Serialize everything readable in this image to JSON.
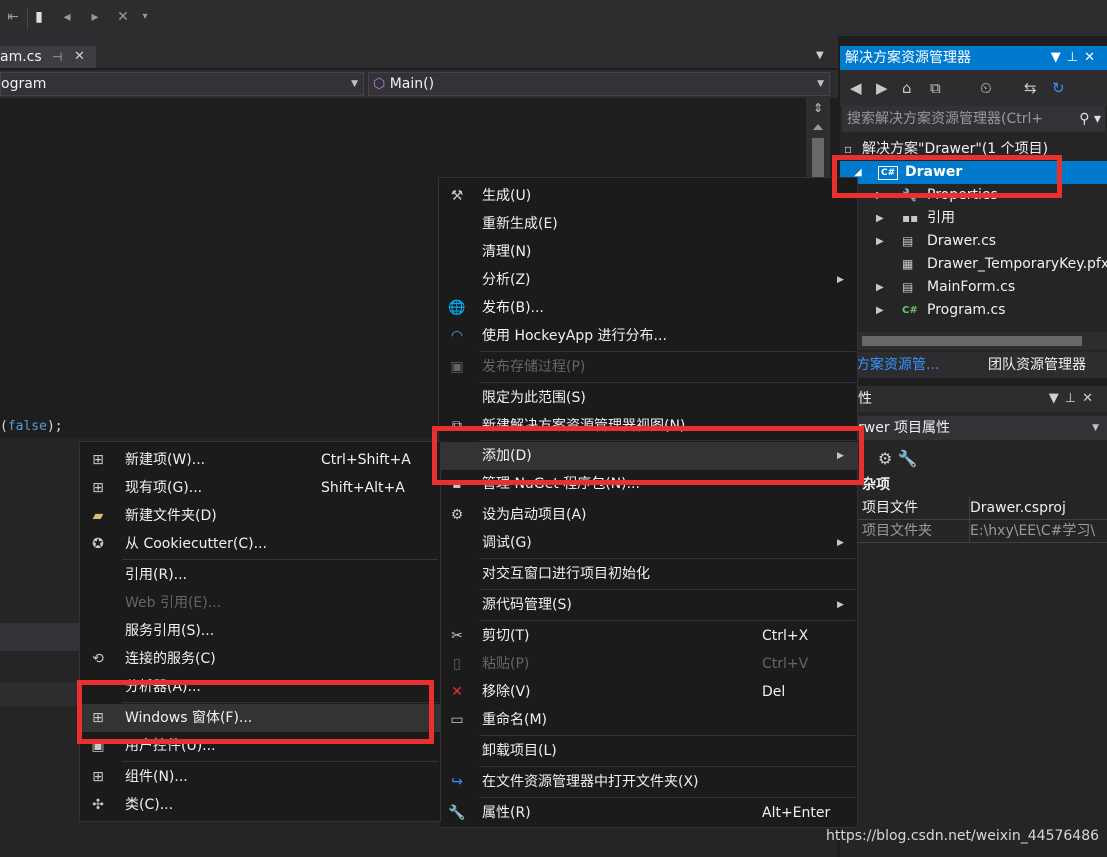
{
  "toolbar": {
    "icons": [
      "outdent-icon",
      "bookmark-icon",
      "prev-bookmark-icon",
      "next-bookmark-icon",
      "clear-bookmarks-icon",
      "toolbar-overflow-icon"
    ]
  },
  "editor": {
    "tab_label": "am.cs",
    "tab_pin": "⊣",
    "tab_close": "✕",
    "nav_left": "ogram",
    "nav_right": "Main()",
    "code_prefix": "(",
    "code_keyword": "false",
    "code_suffix": ");"
  },
  "solution_explorer": {
    "title": "解决方案资源管理器",
    "search_placeholder": "搜索解决方案资源管理器(Ctrl+",
    "items": [
      {
        "label": "解决方案\"Drawer\"(1 个项目)",
        "icon": "solution-icon"
      },
      {
        "label": "Drawer",
        "icon": "csharp-project-icon"
      },
      {
        "label": "Properties",
        "icon": "wrench-icon"
      },
      {
        "label": "引用",
        "icon": "references-icon"
      },
      {
        "label": "Drawer.cs",
        "icon": "form-icon"
      },
      {
        "label": "Drawer_TemporaryKey.pfx",
        "icon": "certificate-icon"
      },
      {
        "label": "MainForm.cs",
        "icon": "form-icon"
      },
      {
        "label": "Program.cs",
        "icon": "csharp-file-icon"
      }
    ],
    "tab_active": "决方案资源管...",
    "tab_other": "团队资源管理器"
  },
  "properties": {
    "title": "性",
    "combo_label": "rwer 项目属性",
    "category": "杂项",
    "rows": [
      {
        "key": "项目文件",
        "value": "Drawer.csproj"
      },
      {
        "key": "项目文件夹",
        "value": "E:\\hxy\\EE\\C#学习\\"
      }
    ]
  },
  "context_menu": {
    "items": [
      {
        "label": "生成(U)",
        "icon": "build-icon"
      },
      {
        "label": "重新生成(E)"
      },
      {
        "label": "清理(N)"
      },
      {
        "label": "分析(Z)",
        "submenu": true
      },
      {
        "label": "发布(B)...",
        "icon": "globe-icon"
      },
      {
        "label": "使用 HockeyApp 进行分布...",
        "icon": "hockeyapp-icon"
      },
      {
        "label": "发布存储过程(P)",
        "icon": "db-publish-icon",
        "disabled": true
      },
      {
        "label": "限定为此范围(S)"
      },
      {
        "label": "新建解决方案资源管理器视图(N)",
        "icon": "new-view-icon"
      },
      {
        "label": "添加(D)",
        "submenu": true,
        "highlighted": true
      },
      {
        "label": "管理 NuGet 程序包(N)...",
        "icon": "nuget-icon"
      },
      {
        "label": "设为启动项目(A)",
        "icon": "gear-icon"
      },
      {
        "label": "调试(G)",
        "submenu": true
      },
      {
        "label": "对交互窗口进行项目初始化"
      },
      {
        "label": "源代码管理(S)",
        "submenu": true
      },
      {
        "label": "剪切(T)",
        "icon": "cut-icon",
        "shortcut": "Ctrl+X"
      },
      {
        "label": "粘贴(P)",
        "icon": "paste-icon",
        "shortcut": "Ctrl+V",
        "disabled": true
      },
      {
        "label": "移除(V)",
        "icon": "remove-icon",
        "shortcut": "Del"
      },
      {
        "label": "重命名(M)",
        "icon": "rename-icon"
      },
      {
        "label": "卸载项目(L)"
      },
      {
        "label": "在文件资源管理器中打开文件夹(X)",
        "icon": "open-folder-icon"
      },
      {
        "label": "属性(R)",
        "icon": "wrench-icon",
        "shortcut": "Alt+Enter"
      }
    ]
  },
  "add_submenu": {
    "items": [
      {
        "label": "新建项(W)...",
        "shortcut": "Ctrl+Shift+A",
        "icon": "new-item-icon"
      },
      {
        "label": "现有项(G)...",
        "shortcut": "Shift+Alt+A",
        "icon": "existing-item-icon"
      },
      {
        "label": "新建文件夹(D)",
        "icon": "new-folder-icon"
      },
      {
        "label": "从 Cookiecutter(C)...",
        "icon": "cookiecutter-icon"
      },
      {
        "label": "引用(R)..."
      },
      {
        "label": "Web 引用(E)...",
        "disabled": true
      },
      {
        "label": "服务引用(S)..."
      },
      {
        "label": "连接的服务(C)",
        "icon": "connected-service-icon"
      },
      {
        "label": "分析器(A)..."
      },
      {
        "label": "Windows 窗体(F)...",
        "icon": "windows-form-icon",
        "highlighted": true
      },
      {
        "label": "用户控件(U)...",
        "icon": "user-control-icon"
      },
      {
        "label": "组件(N)...",
        "icon": "component-icon"
      },
      {
        "label": "类(C)...",
        "icon": "class-icon"
      }
    ]
  },
  "watermark": "https://blog.csdn.net/weixin_44576486",
  "colors": {
    "accent": "#007acc",
    "highlight_box": "#e8312f",
    "menu_bg": "#1b1b1c"
  }
}
